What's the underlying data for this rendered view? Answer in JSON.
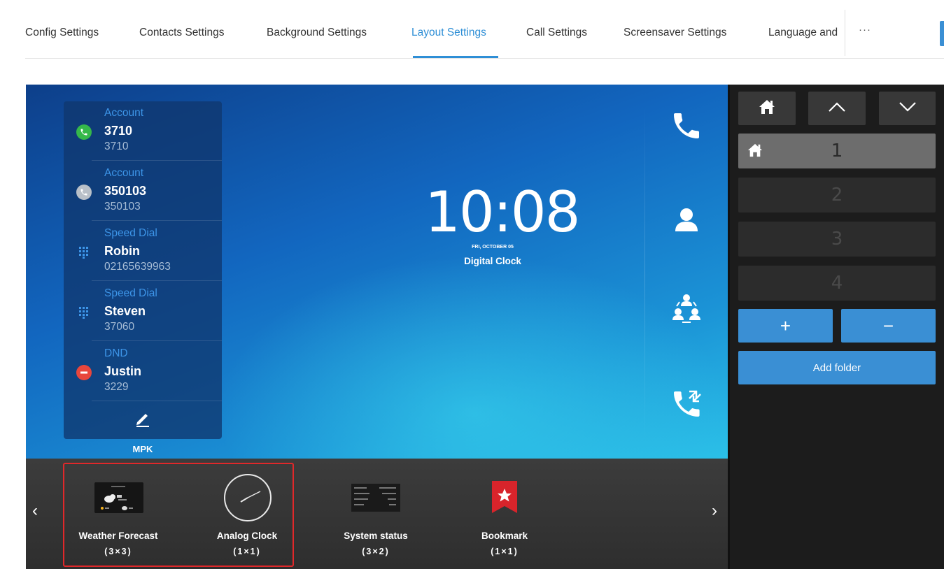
{
  "tabs": [
    {
      "label": "Config Settings",
      "active": false
    },
    {
      "label": "Contacts Settings",
      "active": false
    },
    {
      "label": "Background Settings",
      "active": false
    },
    {
      "label": "Layout Settings",
      "active": true
    },
    {
      "label": "Call Settings",
      "active": false
    },
    {
      "label": "Screensaver Settings",
      "active": false
    },
    {
      "label": "Language and",
      "active": false
    }
  ],
  "tabs_more": "···",
  "mpk": {
    "items": [
      {
        "type": "Account",
        "name": "3710",
        "number": "3710",
        "icon": "phone-icon",
        "color": "#35b84a"
      },
      {
        "type": "Account",
        "name": "350103",
        "number": "350103",
        "icon": "phone-icon",
        "color": "#b9c0c8"
      },
      {
        "type": "Speed Dial",
        "name": "Robin",
        "number": "02165639963",
        "icon": "dialpad-icon",
        "color": "#3d95e8"
      },
      {
        "type": "Speed Dial",
        "name": "Steven",
        "number": "37060",
        "icon": "dialpad-icon",
        "color": "#3d95e8"
      },
      {
        "type": "DND",
        "name": "Justin",
        "number": "3229",
        "icon": "dnd-icon",
        "color": "#e8463c"
      }
    ],
    "label": "MPK"
  },
  "clock": {
    "time": "10:08",
    "date": "FRI, OCTOBER 05",
    "label": "Digital Clock"
  },
  "side_icons": [
    "phone-icon",
    "contacts-icon",
    "conference-icon",
    "call-transfer-icon"
  ],
  "widgets": [
    {
      "name": "Weather Forecast",
      "size": "(3×3)"
    },
    {
      "name": "Analog Clock",
      "size": "(1×1)"
    },
    {
      "name": "System status",
      "size": "(3×2)"
    },
    {
      "name": "Bookmark",
      "size": "(1×1)"
    }
  ],
  "panel": {
    "pages": [
      "1",
      "2",
      "3",
      "4"
    ],
    "active_page": "1",
    "add_label": "+",
    "remove_label": "−",
    "add_folder_label": "Add folder"
  },
  "colors": {
    "accent": "#2f8fd6",
    "button_blue": "#3a8fd4",
    "highlight_red": "#e0282a",
    "panel_bg": "#1c1c1c"
  }
}
